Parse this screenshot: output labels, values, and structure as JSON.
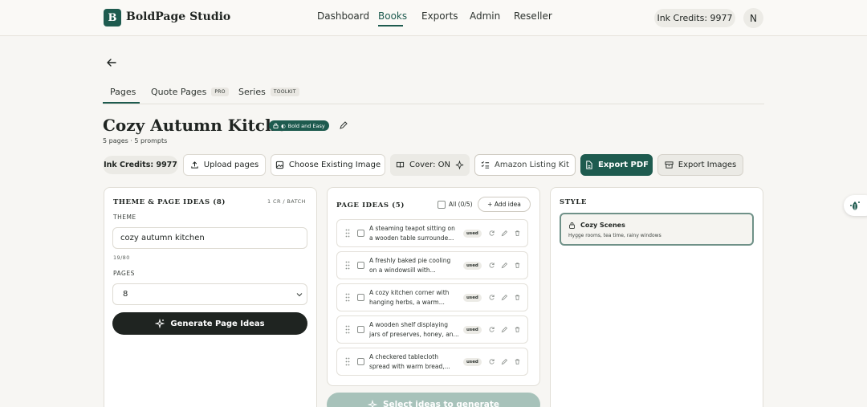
{
  "nav": {
    "logo_letter": "B",
    "brand": "BoldPage Studio",
    "items": [
      "Dashboard",
      "Books",
      "Exports",
      "Admin",
      "Reseller"
    ],
    "active": "Books",
    "credits": "Ink Credits: 9977",
    "avatar": "N"
  },
  "tabs": {
    "pages": "Pages",
    "quote_pages": "Quote Pages",
    "quote_badge": "PRO",
    "series": "Series",
    "series_badge": "TOOLKIT"
  },
  "book": {
    "title": "Cozy Autumn Kitchen",
    "style_badge": "Bold and Easy",
    "subtitle": "5 pages · 5 prompts"
  },
  "actions": {
    "credits": "Ink Credits: 9977",
    "upload": "Upload pages",
    "choose_image": "Choose Existing Image",
    "cover": "Cover: ON",
    "amazon": "Amazon Listing Kit",
    "export_pdf": "Export PDF",
    "export_images": "Export Images"
  },
  "theme_panel": {
    "heading": "THEME & PAGE IDEAS (8)",
    "batch": "1 CR / BATCH",
    "theme_label": "THEME",
    "theme_value": "cozy autumn kitchen",
    "char_count": "19/80",
    "pages_label": "PAGES",
    "pages_value": "8",
    "generate": "Generate Page Ideas"
  },
  "ideas_panel": {
    "heading": "PAGE IDEAS (5)",
    "all_label": "All (0/5)",
    "add_idea": "+ Add idea",
    "used_label": "used",
    "ideas": [
      "A steaming teapot sitting on a wooden table surrounde...",
      "A freshly baked pie cooling on a windowsill with...",
      "A cozy kitchen corner with hanging herbs, a warm...",
      "A wooden shelf displaying jars of preserves, honey, an...",
      "A checkered tablecloth spread with warm bread,..."
    ],
    "select_button": "Select ideas to generate"
  },
  "style_panel": {
    "heading": "STYLE",
    "name": "Cozy Scenes",
    "desc": "Hygge rooms, tea time, rainy windows"
  },
  "colors": {
    "accent": "#1e5b4f",
    "background": "#f7f6f3",
    "disabled_button": "#a7c2ba"
  }
}
